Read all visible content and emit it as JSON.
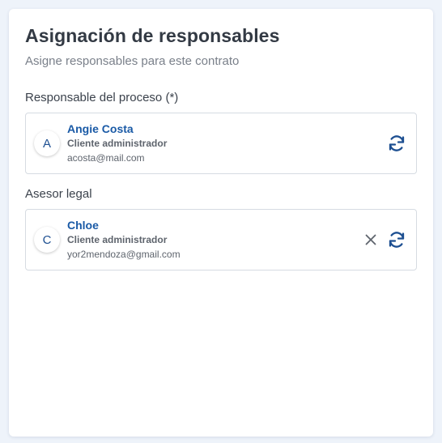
{
  "header": {
    "title": "Asignación de responsables",
    "subtitle": "Asigne responsables para este contrato"
  },
  "sections": [
    {
      "label": "Responsable del proceso (*)",
      "user": {
        "initial": "A",
        "name": "Angie Costa",
        "role": "Cliente administrador",
        "email": "acosta@mail.com"
      },
      "actions": [
        "refresh-icon"
      ]
    },
    {
      "label": "Asesor legal",
      "user": {
        "initial": "C",
        "name": "Chloe",
        "role": "Cliente administrador",
        "email": "yor2mendoza@gmail.com"
      },
      "actions": [
        "close-icon",
        "refresh-icon"
      ]
    }
  ],
  "colors": {
    "accent": "#1a5aa6",
    "icon_blue": "#1d4f91",
    "icon_gray": "#5e646d",
    "border": "#d6dbe2",
    "background": "#eef3fa"
  }
}
